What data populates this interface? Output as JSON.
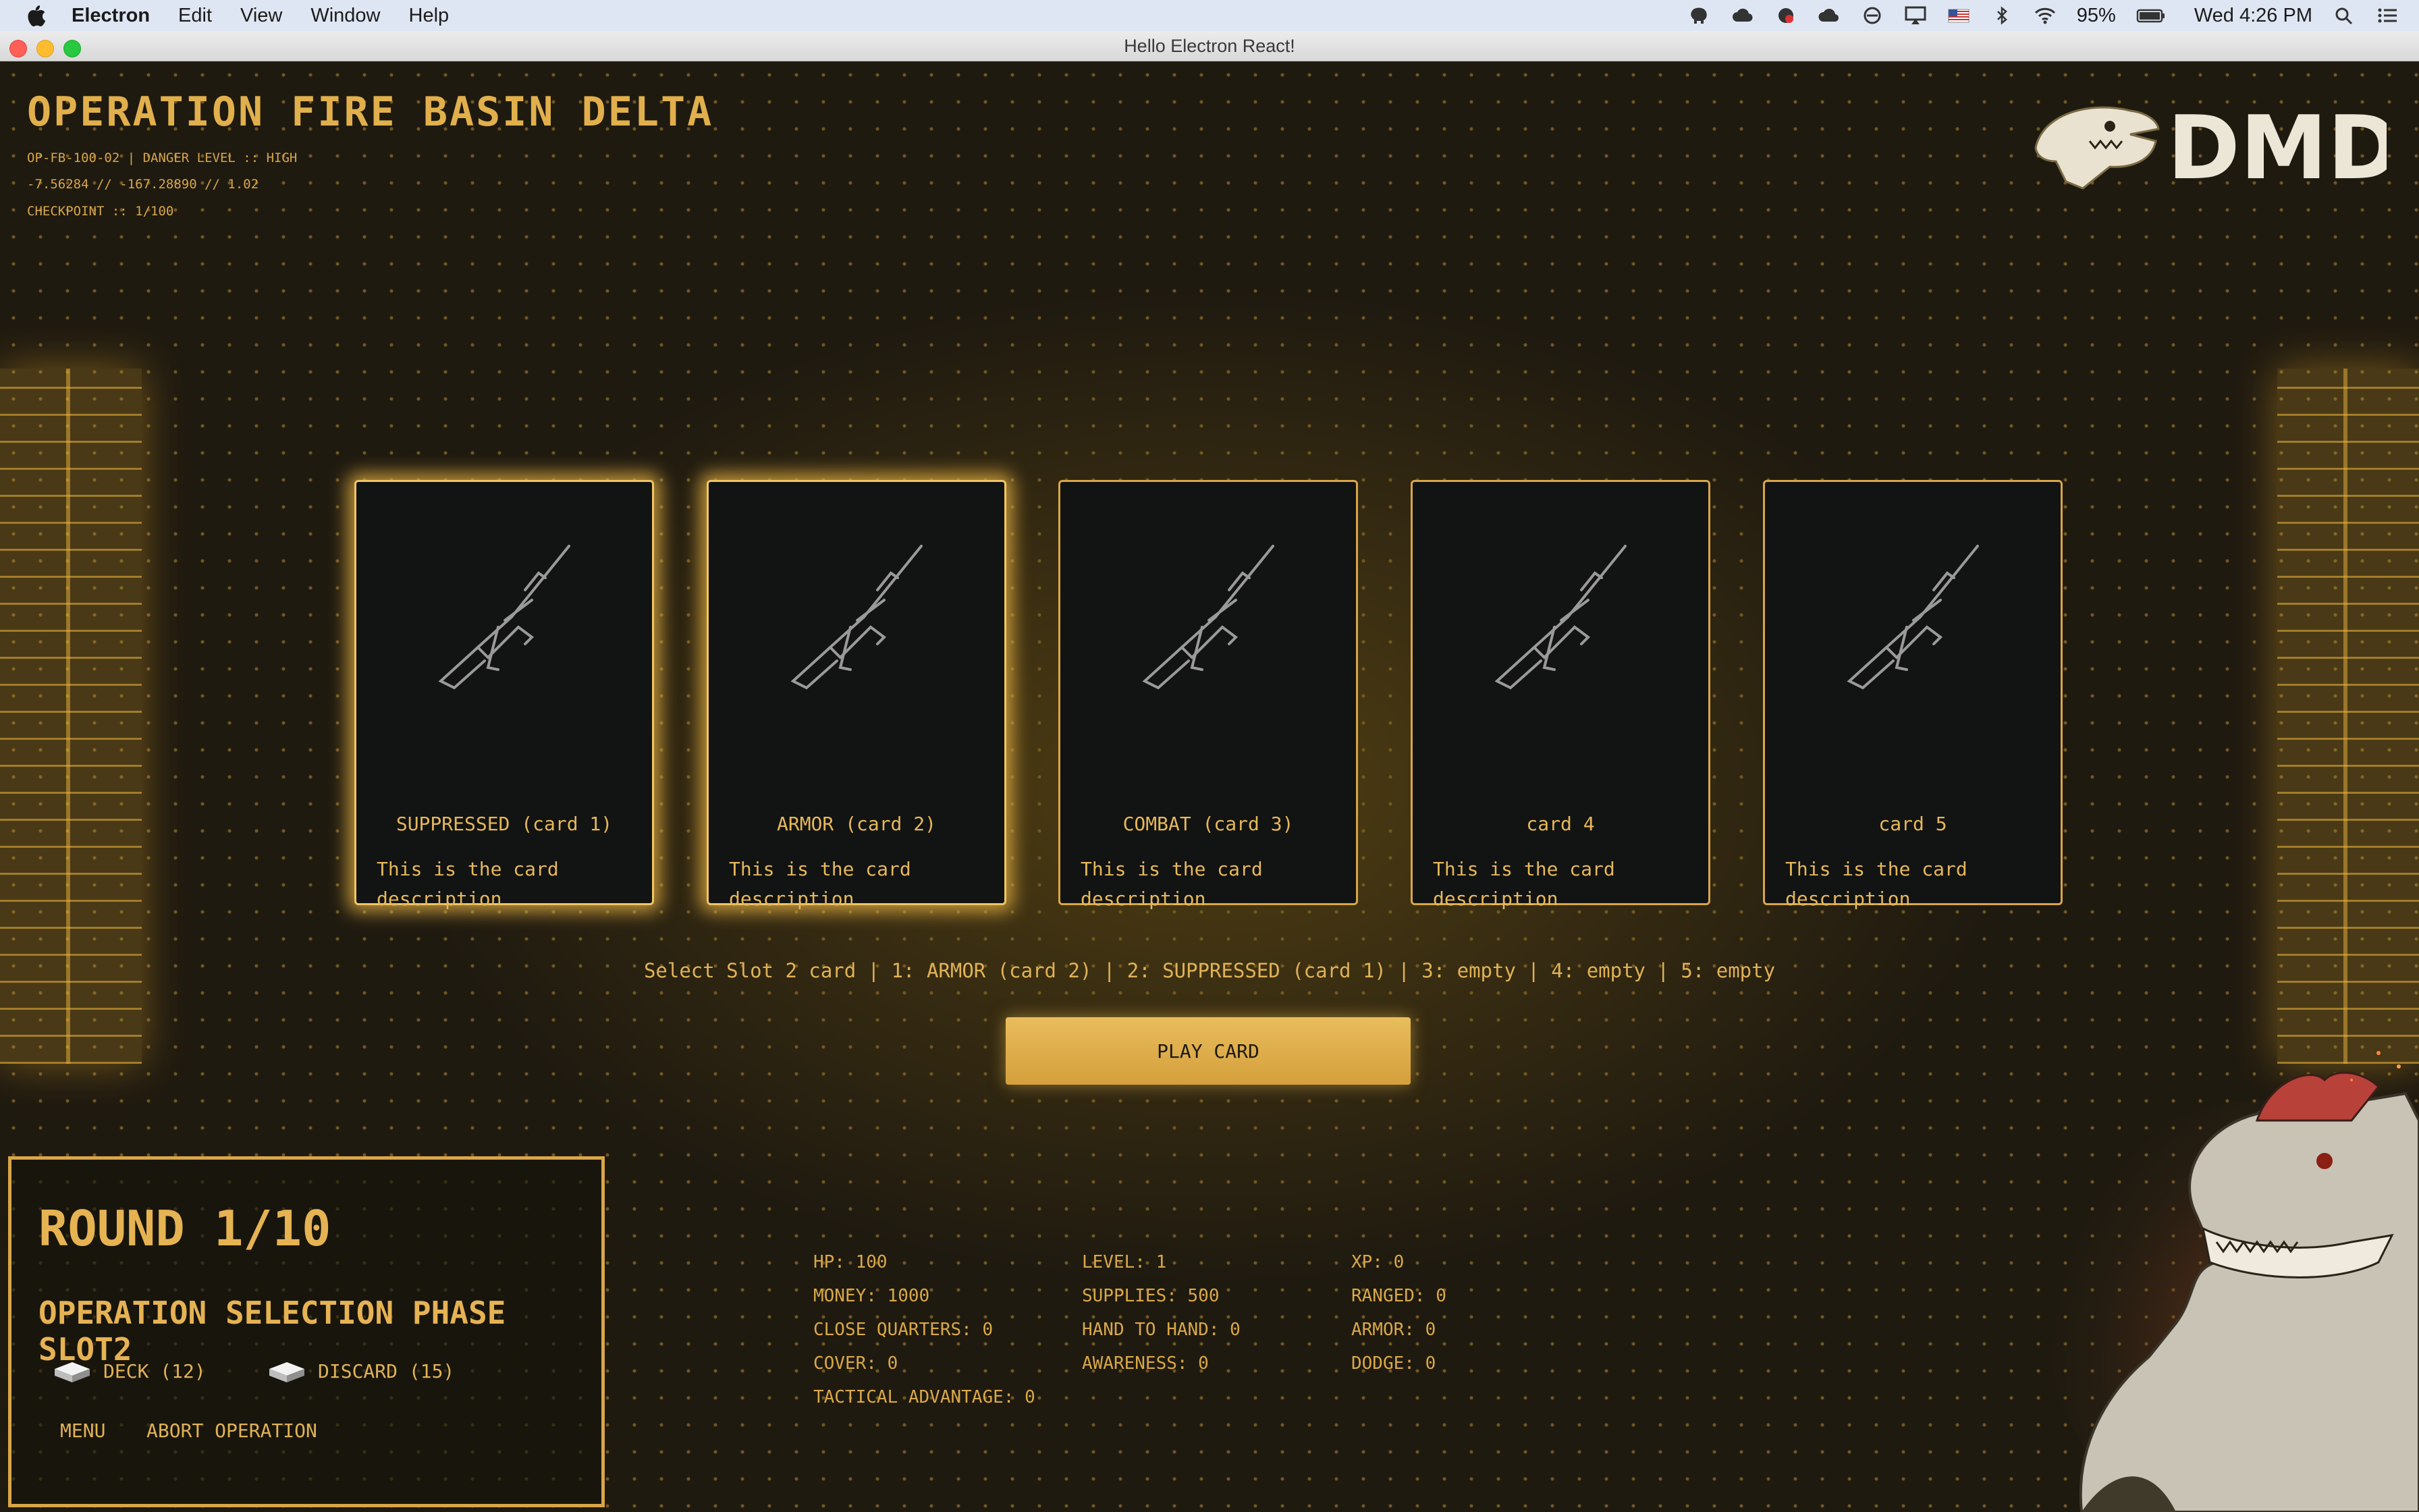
{
  "menubar": {
    "app_name": "Electron",
    "items": [
      "Edit",
      "View",
      "Window",
      "Help"
    ],
    "battery": "95%",
    "clock": "Wed 4:26 PM"
  },
  "window": {
    "title": "Hello Electron React!"
  },
  "operation": {
    "title": "OPERATION FIRE BASIN DELTA",
    "meta": [
      "OP-FB-100-02 | DANGER LEVEL :: HIGH",
      "-7.56284 // -167.28890 // 1.02",
      "CHECKPOINT :: 1/100"
    ],
    "logo_text": "DMDC"
  },
  "cards": [
    {
      "name": "SUPPRESSED (card 1)",
      "description": "This is the card description",
      "selected": true
    },
    {
      "name": "ARMOR (card 2)",
      "description": "This is the card description",
      "selected": true
    },
    {
      "name": "COMBAT (card 3)",
      "description": "This is the card description",
      "selected": false
    },
    {
      "name": "card 4",
      "description": "This is the card description",
      "selected": false
    },
    {
      "name": "card 5",
      "description": "This is the card description",
      "selected": false
    }
  ],
  "status_line": "Select Slot 2 card | 1: ARMOR (card 2) | 2: SUPPRESSED (card 1) | 3: empty | 4: empty | 5: empty",
  "play_button": "PLAY CARD",
  "round_panel": {
    "round": "ROUND 1/10",
    "phase": "OPERATION SELECTION PHASE SLOT2",
    "deck": "DECK (12)",
    "discard": "DISCARD (15)",
    "menu": "MENU",
    "abort": "ABORT OPERATION"
  },
  "stats": {
    "col1": [
      "HP: 100",
      "MONEY: 1000",
      "CLOSE QUARTERS: 0",
      "COVER: 0",
      "TACTICAL ADVANTAGE: 0"
    ],
    "col2": [
      "LEVEL: 1",
      "SUPPLIES: 500",
      "HAND TO HAND: 0",
      "AWARENESS: 0"
    ],
    "col3": [
      "XP: 0",
      "RANGED: 0",
      "ARMOR: 0",
      "DODGE: 0"
    ]
  },
  "colors": {
    "accent": "#e1b04c",
    "card_bg": "#121313",
    "panel_border": "#d9a648"
  }
}
